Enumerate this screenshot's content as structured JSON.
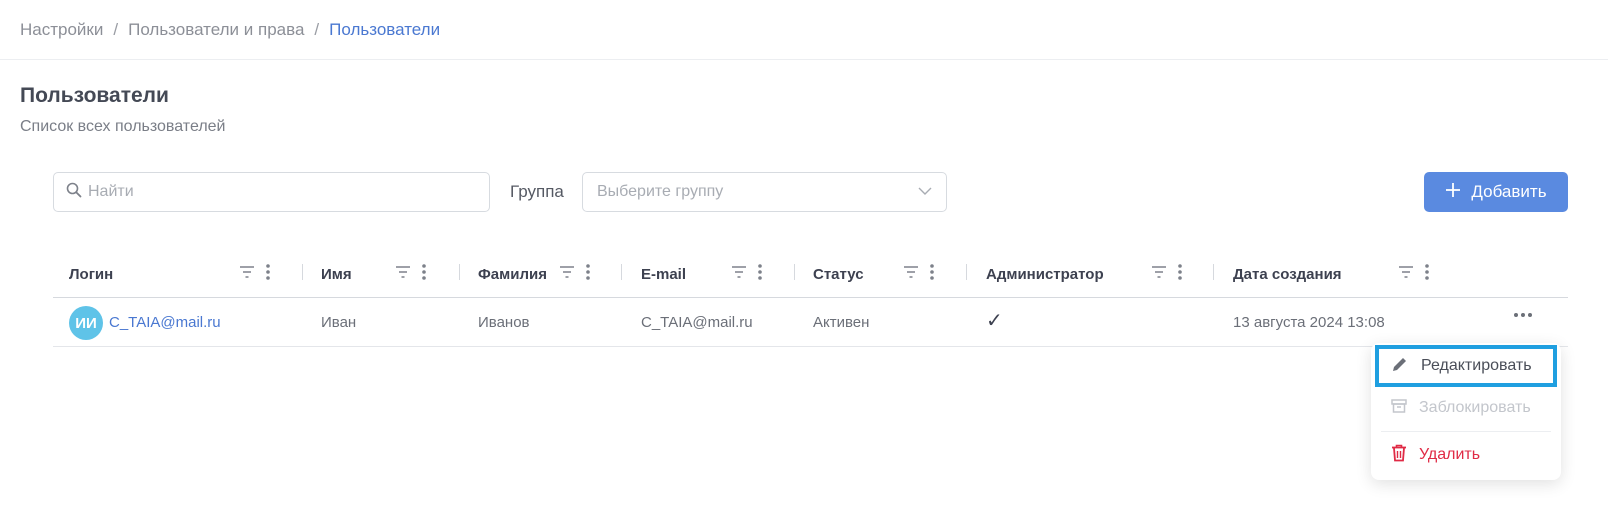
{
  "breadcrumb": {
    "items": [
      "Настройки",
      "Пользователи и права"
    ],
    "current": "Пользователи",
    "separator": "/"
  },
  "page": {
    "title": "Пользователи",
    "subtitle": "Список всех пользователей"
  },
  "toolbar": {
    "search_placeholder": "Найти",
    "group_label": "Группа",
    "group_placeholder": "Выберите группу",
    "add_label": "Добавить"
  },
  "table": {
    "columns": [
      "Логин",
      "Имя",
      "Фамилия",
      "E-mail",
      "Статус",
      "Администратор",
      "Дата создания"
    ],
    "rows": [
      {
        "avatar_initials": "ИИ",
        "login": "C_TAIA@mail.ru",
        "first_name": "Иван",
        "last_name": "Иванов",
        "email": "C_TAIA@mail.ru",
        "status": "Активен",
        "admin": "✓",
        "created": "13 августа 2024 13:08"
      }
    ]
  },
  "row_menu": {
    "edit": "Редактировать",
    "block": "Заблокировать",
    "delete": "Удалить"
  },
  "colors": {
    "accent": "#5a8ae0",
    "link": "#4a78d1",
    "avatar": "#5fc3e8",
    "danger": "#e02a45",
    "highlight": "#1f9fe0"
  },
  "icons": [
    "search-icon",
    "chevron-down-icon",
    "plus-icon",
    "filter-icon",
    "kebab-icon",
    "more-horizontal-icon",
    "pencil-icon",
    "archive-icon",
    "trash-icon",
    "check-icon"
  ]
}
